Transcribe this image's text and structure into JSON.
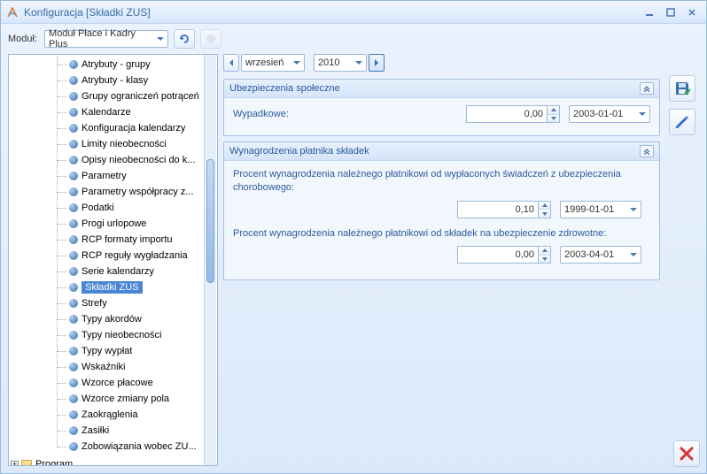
{
  "window": {
    "title": "Konfiguracja [Składki ZUS]"
  },
  "toolbar": {
    "module_label": "Moduł:",
    "module_value": "Moduł Płace i Kadry Plus"
  },
  "date_nav": {
    "month": "wrzesień",
    "year": "2010"
  },
  "tree": {
    "items": [
      "Atrybuty - grupy",
      "Atrybuty - klasy",
      "Grupy ograniczeń potrąceń",
      "Kalendarze",
      "Konfiguracja kalendarzy",
      "Limity nieobecności",
      "Opisy nieobecności do k...",
      "Parametry",
      "Parametry współpracy z...",
      "Podatki",
      "Progi urlopowe",
      "RCP formaty importu",
      "RCP reguły wygładzania",
      "Serie kalendarzy",
      "Składki ZUS",
      "Strefy",
      "Typy akordów",
      "Typy nieobecności",
      "Typy wypłat",
      "Wskaźniki",
      "Wzorce płacowe",
      "Wzorce zmiany pola",
      "Zaokrąglenia",
      "Zasiłki",
      "Zobowiązania wobec ZU..."
    ],
    "selected_index": 14,
    "root": "Program"
  },
  "panel1": {
    "title": "Ubezpieczenia społeczne",
    "row1_label": "Wypadkowe:",
    "row1_value": "0,00",
    "row1_date": "2003-01-01"
  },
  "panel2": {
    "title": "Wynagrodzenia płatnika składek",
    "desc1": "Procent wynagrodzenia należnego płatnikowi od wypłaconych świadczeń z ubezpieczenia chorobowego:",
    "value1": "0,10",
    "date1": "1999-01-01",
    "desc2": "Procent wynagrodzenia należnego płatnikowi od składek na ubezpieczenie zdrowotne:",
    "value2": "0,00",
    "date2": "2003-04-01"
  }
}
